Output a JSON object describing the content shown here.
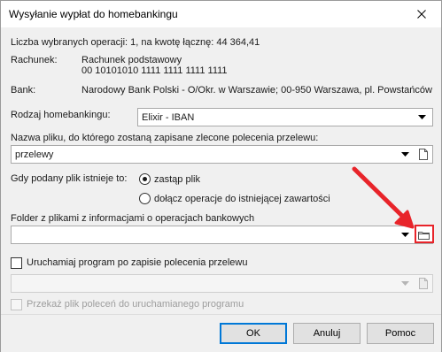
{
  "window": {
    "title": "Wysyłanie wypłat do homebankingu"
  },
  "summary": {
    "text": "Liczba wybranych operacji: 1, na kwotę łącznę: 44 364,41"
  },
  "account": {
    "label": "Rachunek:",
    "name": "Rachunek podstawowy",
    "number": "00 10101010 1111 1111 1111 1111"
  },
  "bank": {
    "label": "Bank:",
    "value": "Narodowy Bank Polski  - O/Okr. w Warszawie; 00-950 Warszawa, pl. Powstańców"
  },
  "homebanking": {
    "label": "Rodzaj homebankingu:",
    "value": "Elixir - IBAN"
  },
  "filename": {
    "label": "Nazwa pliku, do którego zostaną zapisane zlecone polecenia przelewu:",
    "value": "przelewy"
  },
  "file_exists": {
    "label": "Gdy podany plik istnieje to:",
    "options": [
      {
        "label": "zastąp plik",
        "selected": true
      },
      {
        "label": "dołącz operacje do istniejącej zawartości",
        "selected": false
      }
    ]
  },
  "folder": {
    "label": "Folder z plikami z informacjami o operacjach bankowych",
    "value": ""
  },
  "run_program": {
    "label": "Uruchamiaj program po zapisie polecenia przelewu",
    "checked": false,
    "program_value": ""
  },
  "pass_file": {
    "label": "Przekaż plik poleceń do uruchamianego programu",
    "checked": false,
    "enabled": false
  },
  "buttons": {
    "ok": "OK",
    "cancel": "Anuluj",
    "help": "Pomoc"
  },
  "colors": {
    "accent": "#0078d7",
    "annotation": "#e8242a"
  },
  "icons": {
    "close": "close-icon",
    "dropdown": "chevron-down-icon",
    "file": "file-icon",
    "folder": "folder-icon"
  }
}
